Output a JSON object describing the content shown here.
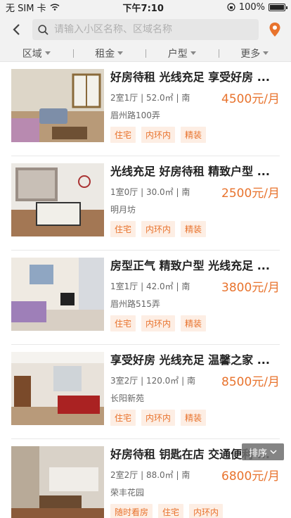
{
  "statusbar": {
    "carrier": "无 SIM 卡",
    "time": "下午7:10",
    "battery": "100%"
  },
  "search": {
    "placeholder": "请输入小区名称、区域名称"
  },
  "filters": [
    {
      "label": "区域"
    },
    {
      "label": "租金"
    },
    {
      "label": "户型"
    },
    {
      "label": "更多"
    }
  ],
  "listings": [
    {
      "title": "好房待租 光线充足 享受好房 ...",
      "spec": "2室1厅 | 52.0㎡ | 南",
      "price": "4500元/月",
      "addr": "眉州路100弄",
      "tags": [
        "住宅",
        "内环内",
        "精装"
      ]
    },
    {
      "title": "光线充足 好房待租 精致户型 ...",
      "spec": "1室0厅 | 30.0㎡ | 南",
      "price": "2500元/月",
      "addr": "明月坊",
      "tags": [
        "住宅",
        "内环内",
        "精装"
      ]
    },
    {
      "title": "房型正气 精致户型 光线充足 ...",
      "spec": "1室1厅 | 42.0㎡ | 南",
      "price": "3800元/月",
      "addr": "眉州路515弄",
      "tags": [
        "住宅",
        "内环内",
        "精装"
      ]
    },
    {
      "title": "享受好房 光线充足 温馨之家 ...",
      "spec": "3室2厅 | 120.0㎡ | 南",
      "price": "8500元/月",
      "addr": "长阳新苑",
      "tags": [
        "住宅",
        "内环内",
        "精装"
      ]
    },
    {
      "title": "好房待租 钥匙在店 交通便利 ...",
      "spec": "2室2厅 | 88.0㎡ | 南",
      "price": "6800元/月",
      "addr": "荣丰花园",
      "tags": [
        "随时看房",
        "住宅",
        "内环内"
      ]
    }
  ],
  "sort": {
    "label": "排序"
  },
  "colors": {
    "accent": "#e8732d",
    "tag_bg": "#fdeee4"
  }
}
